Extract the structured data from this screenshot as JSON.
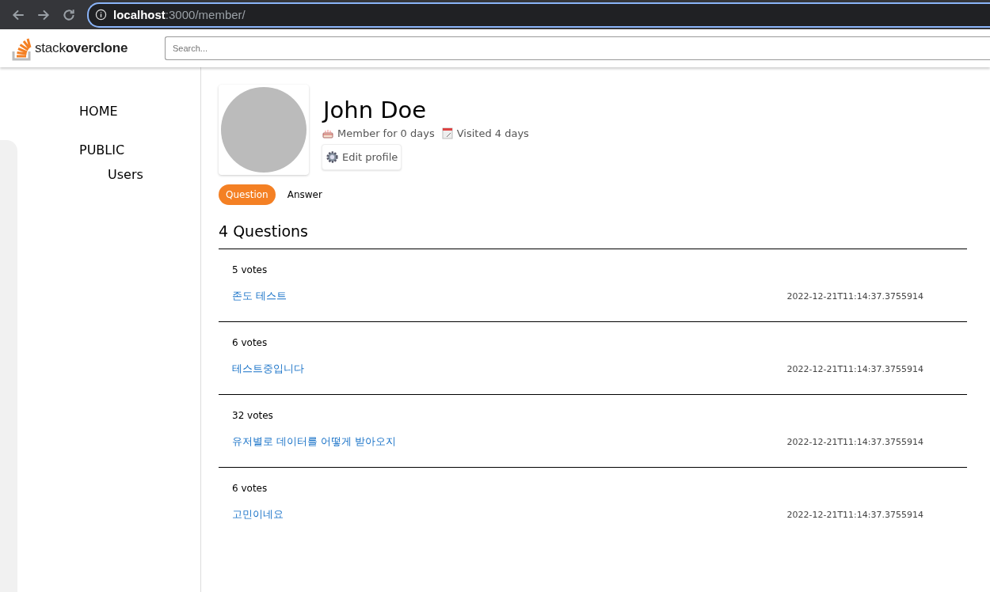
{
  "browser": {
    "url": "**localhost**:3000/member/"
  },
  "header": {
    "logo": "stack**overclone**",
    "search": {
      "placeholder": "Search..."
    }
  },
  "sidebar": {
    "items": [
      {
        "label": "HOME"
      },
      {
        "label": "PUBLIC",
        "children": [
          {
            "label": "Users"
          }
        ]
      }
    ]
  },
  "profile": {
    "name": "John Doe",
    "member_for": "Member for 0 days",
    "visited": "Visited 4 days",
    "edit_button": "Edit profile"
  },
  "tabs": [
    {
      "label": "Question",
      "selected": true
    },
    {
      "label": "Answer",
      "selected": false
    }
  ],
  "list_title": "4 Questions",
  "questions": [
    {
      "votes": "5 votes",
      "title": "존도 테스트",
      "date": "2022-12-21T11:14:37.3755914"
    },
    {
      "votes": "6 votes",
      "title": "테스트중입니다",
      "date": "2022-12-21T11:14:37.3755914"
    },
    {
      "votes": "32 votes",
      "title": "유저별로 데이터를 어떻게 받아오지",
      "date": "2022-12-21T11:14:37.3755914"
    },
    {
      "votes": "6 votes",
      "title": "고민이네요",
      "date": "2022-12-21T11:14:37.3755914"
    }
  ]
}
